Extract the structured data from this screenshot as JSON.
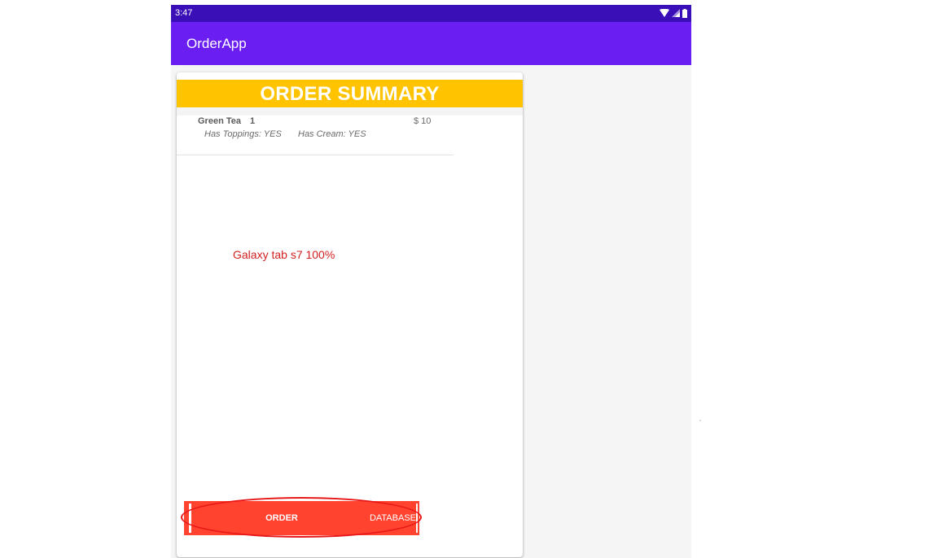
{
  "status_bar": {
    "time": "3:47",
    "icons": [
      "wifi-icon",
      "signal-icon",
      "battery-icon"
    ]
  },
  "app_bar": {
    "title": "OrderApp"
  },
  "summary": {
    "title": "ORDER SUMMARY",
    "items": [
      {
        "name": "Green Tea",
        "quantity": "1",
        "price": "$ 10",
        "toppings": "Has Toppings: YES",
        "cream": "Has Cream: YES"
      }
    ]
  },
  "annotation": {
    "text": "Galaxy tab s7 100%"
  },
  "buttons": {
    "order_label": "ORDER",
    "database_label": "DATABASE"
  },
  "colors": {
    "status_bar": "#3a0fb8",
    "app_bar": "#6a1ef2",
    "header": "#ffc300",
    "button": "#ff432f",
    "annotation": "#d32020"
  }
}
